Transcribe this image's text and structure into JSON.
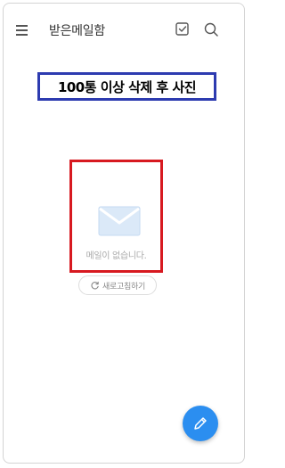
{
  "header": {
    "title": "받은메일함",
    "menu_icon": "hamburger-menu-icon",
    "check_icon": "checkbox-select-icon",
    "search_icon": "search-icon"
  },
  "overlay_label": "100통 이상 삭제 후 사진",
  "empty_state": {
    "icon": "envelope-icon",
    "message": "메일이 없습니다."
  },
  "refresh_button": {
    "icon": "refresh-icon",
    "label": "새로고침하기"
  },
  "compose_button": {
    "icon": "pencil-icon"
  },
  "colors": {
    "accent": "#2b8ef0",
    "overlay_blue": "#2d3bb0",
    "overlay_red": "#d71920"
  }
}
